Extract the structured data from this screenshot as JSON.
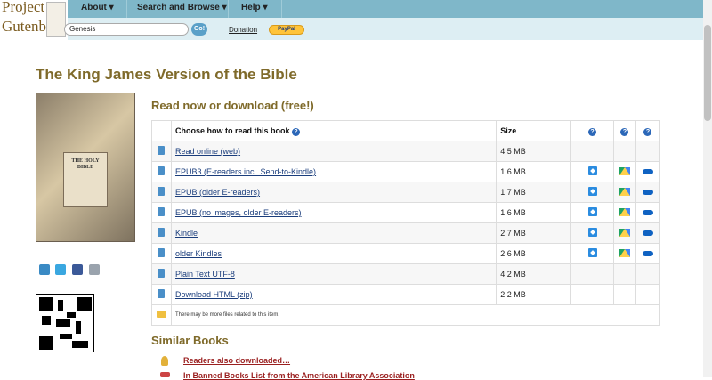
{
  "header": {
    "logo_line1": "Project",
    "logo_line2": "Gutenberg",
    "nav": [
      {
        "label": "About",
        "caret": "▾"
      },
      {
        "label": "Search and Browse",
        "caret": "▾"
      },
      {
        "label": "Help",
        "caret": "▾"
      }
    ],
    "search": {
      "value": "Genesis"
    },
    "go_label": "Go!",
    "donation_label": "Donation",
    "paypal_label": "PayPal"
  },
  "page": {
    "title": "The King James Version of the Bible",
    "cover_text": "THE HOLY BIBLE"
  },
  "download": {
    "heading": "Read now or download (free!)",
    "columns": {
      "choose": "Choose how to read this book",
      "size": "Size"
    },
    "rows": [
      {
        "label": "Read online (web)",
        "size": "4.5 MB",
        "dropbox": false,
        "gdrive": false,
        "onedrive": false
      },
      {
        "label": "EPUB3 (E-readers incl. Send-to-Kindle)",
        "size": "1.6 MB",
        "dropbox": true,
        "gdrive": true,
        "onedrive": true
      },
      {
        "label": "EPUB (older E-readers)",
        "size": "1.7 MB",
        "dropbox": true,
        "gdrive": true,
        "onedrive": true
      },
      {
        "label": "EPUB (no images, older E-readers)",
        "size": "1.6 MB",
        "dropbox": true,
        "gdrive": true,
        "onedrive": true
      },
      {
        "label": "Kindle",
        "size": "2.7 MB",
        "dropbox": true,
        "gdrive": true,
        "onedrive": true
      },
      {
        "label": "older Kindles",
        "size": "2.6 MB",
        "dropbox": true,
        "gdrive": true,
        "onedrive": true
      },
      {
        "label": "Plain Text UTF-8",
        "size": "4.2 MB",
        "dropbox": false,
        "gdrive": false,
        "onedrive": false
      },
      {
        "label": "Download HTML (zip)",
        "size": "2.2 MB",
        "dropbox": false,
        "gdrive": false,
        "onedrive": false
      }
    ],
    "more_files_note": "There may be more files related to this item."
  },
  "similar": {
    "heading": "Similar Books",
    "items": [
      "Readers also downloaded…",
      "In Banned Books List from the American Library Association"
    ]
  },
  "icons": {
    "book": "book-icon",
    "folder": "folder-icon",
    "help": "help-icon",
    "dropbox": "dropbox-icon",
    "gdrive": "google-drive-icon",
    "onedrive": "onedrive-icon"
  },
  "colors": {
    "nav_bg": "#7fb7c9",
    "search_bg": "#ddeef3",
    "title": "#7f6a2a",
    "link": "#1a3d7c",
    "similar_link": "#9a1f1f"
  }
}
